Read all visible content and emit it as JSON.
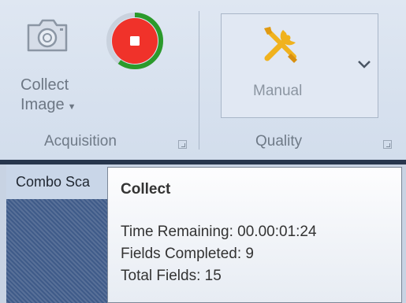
{
  "ribbon": {
    "acquisition": {
      "collect_button": {
        "label_line1": "Collect",
        "label_line2": "Image",
        "icon": "camera-icon"
      },
      "stop_button": {
        "icon": "stop-icon",
        "progress_fraction": 0.6
      },
      "group_label": "Acquisition"
    },
    "quality": {
      "mode_button": {
        "label": "Manual",
        "icon": "wrench-screwdriver-icon"
      },
      "group_label": "Quality"
    }
  },
  "document_tab": {
    "label": "Combo Sca"
  },
  "tooltip": {
    "title": "Collect",
    "lines": [
      "Time Remaining: 00.00:01:24",
      "Fields Completed: 9",
      "Total Fields: 15"
    ]
  },
  "colors": {
    "stop_red": "#f0322a",
    "progress_green": "#2b9a2b",
    "tools_yellow": "#f0b21e",
    "panel_blue": "#3f5b89"
  }
}
